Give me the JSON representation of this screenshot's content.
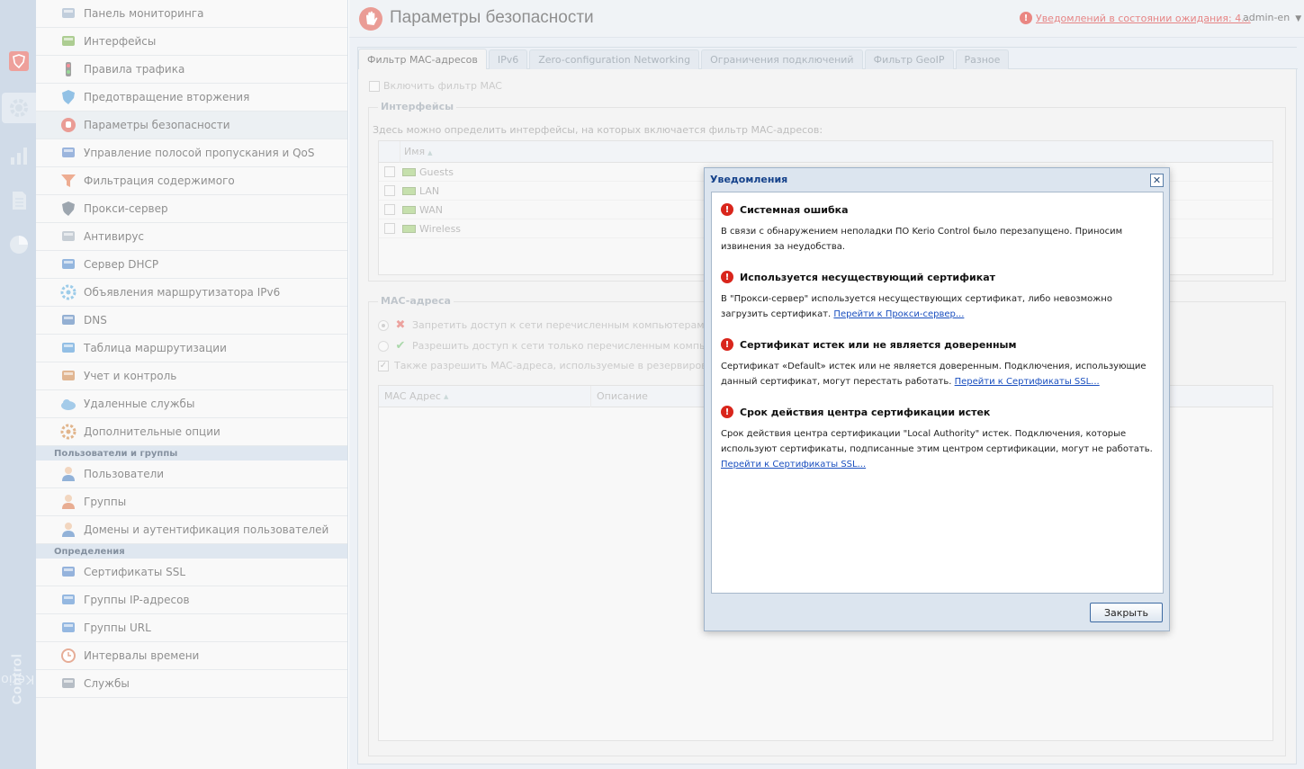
{
  "brand": {
    "name_a": "Kerio",
    "name_b": "Control"
  },
  "nav": {
    "items": [
      {
        "label": "Панель мониторинга",
        "icon": "dashboard-icon"
      },
      {
        "label": "Интерфейсы",
        "icon": "network-card-icon"
      },
      {
        "label": "Правила трафика",
        "icon": "traffic-light-icon"
      },
      {
        "label": "Предотвращение вторжения",
        "icon": "shield-icon"
      },
      {
        "label": "Параметры безопасности",
        "icon": "hand-stop-icon"
      },
      {
        "label": "Управление полосой пропускания и QoS",
        "icon": "bandwidth-icon"
      },
      {
        "label": "Фильтрация содержимого",
        "icon": "funnel-icon"
      },
      {
        "label": "Прокси-сервер",
        "icon": "proxy-shield-icon"
      },
      {
        "label": "Антивирус",
        "icon": "syringe-icon"
      },
      {
        "label": "Сервер DHCP",
        "icon": "monitor-icon"
      },
      {
        "label": "Объявления маршрутизатора IPv6",
        "icon": "fan-icon"
      },
      {
        "label": "DNS",
        "icon": "dns-tree-icon"
      },
      {
        "label": "Таблица маршрутизации",
        "icon": "routing-icon"
      },
      {
        "label": "Учет и контроль",
        "icon": "accounting-icon"
      },
      {
        "label": "Удаленные службы",
        "icon": "cloud-icon"
      },
      {
        "label": "Дополнительные опции",
        "icon": "gears-icon"
      }
    ],
    "group_users": "Пользователи и группы",
    "users_items": [
      {
        "label": "Пользователи",
        "icon": "user-icon"
      },
      {
        "label": "Группы",
        "icon": "group-icon"
      },
      {
        "label": "Домены и аутентификация пользователей",
        "icon": "domain-user-icon"
      }
    ],
    "group_defs": "Определения",
    "defs_items": [
      {
        "label": "Сертификаты SSL",
        "icon": "certificate-icon"
      },
      {
        "label": "Группы IP-адресов",
        "icon": "ip-group-icon"
      },
      {
        "label": "Группы URL",
        "icon": "url-group-icon"
      },
      {
        "label": "Интервалы времени",
        "icon": "clock-icon"
      },
      {
        "label": "Службы",
        "icon": "services-icon"
      }
    ]
  },
  "header": {
    "title": "Параметры безопасности",
    "notifications_link": "Уведомлений в состоянии ожидания: 4...",
    "user": "admin-en"
  },
  "tabs": [
    "Фильтр MAC-адресов",
    "IPv6",
    "Zero-configuration Networking",
    "Ограничения подключений",
    "Фильтр GeoIP",
    "Разное"
  ],
  "mac_filter": {
    "enable_label": "Включить фильтр MAC",
    "interfaces_legend": "Интерфейсы",
    "interfaces_desc": "Здесь можно определить интерфейсы, на которых включается фильтр MAC-адресов:",
    "name_column": "Имя",
    "interfaces": [
      "Guests",
      "LAN",
      "WAN",
      "Wireless"
    ],
    "macs_legend": "MAC-адреса",
    "deny_label": "Запретить доступ к сети перечисленным компьютерам",
    "allow_label": "Разрешить доступ к сети только перечисленным компьютерам",
    "also_allow_label": "Также разрешить MAC-адреса, используемые в резервировании DH",
    "col_mac": "MAC Адрес",
    "col_desc": "Описание"
  },
  "dialog": {
    "title": "Уведомления",
    "close_button": "Закрыть",
    "messages": [
      {
        "heading": "Системная ошибка",
        "text": "В связи с обнаружением неполадки ПО Kerio Control было перезапущено. Приносим извинения за неудобства.",
        "link": ""
      },
      {
        "heading": "Используется несуществующий сертификат",
        "text": "В \"Прокси-сервер\" используется несуществующих сертификат, либо невозможно загрузить сертификат.",
        "link": "Перейти к Прокси-сервер..."
      },
      {
        "heading": "Сертификат истек или не является доверенным",
        "text": "Сертификат «Default» истек или не является доверенным. Подключения, использующие данный сертификат, могут перестать работать.",
        "link": "Перейти к Сертификаты SSL..."
      },
      {
        "heading": "Срок действия центра сертификации истек",
        "text": "Срок действия центра сертификации \"Local Authority\" истек. Подключения, которые используют сертификаты, подписанные этим центром сертификации, могут не работать.",
        "link": "Перейти к Сертификаты SSL..."
      }
    ]
  },
  "colors": {
    "accent_red": "#d9261c",
    "link_blue": "#1a4fbf",
    "header_blue": "#15428b"
  }
}
